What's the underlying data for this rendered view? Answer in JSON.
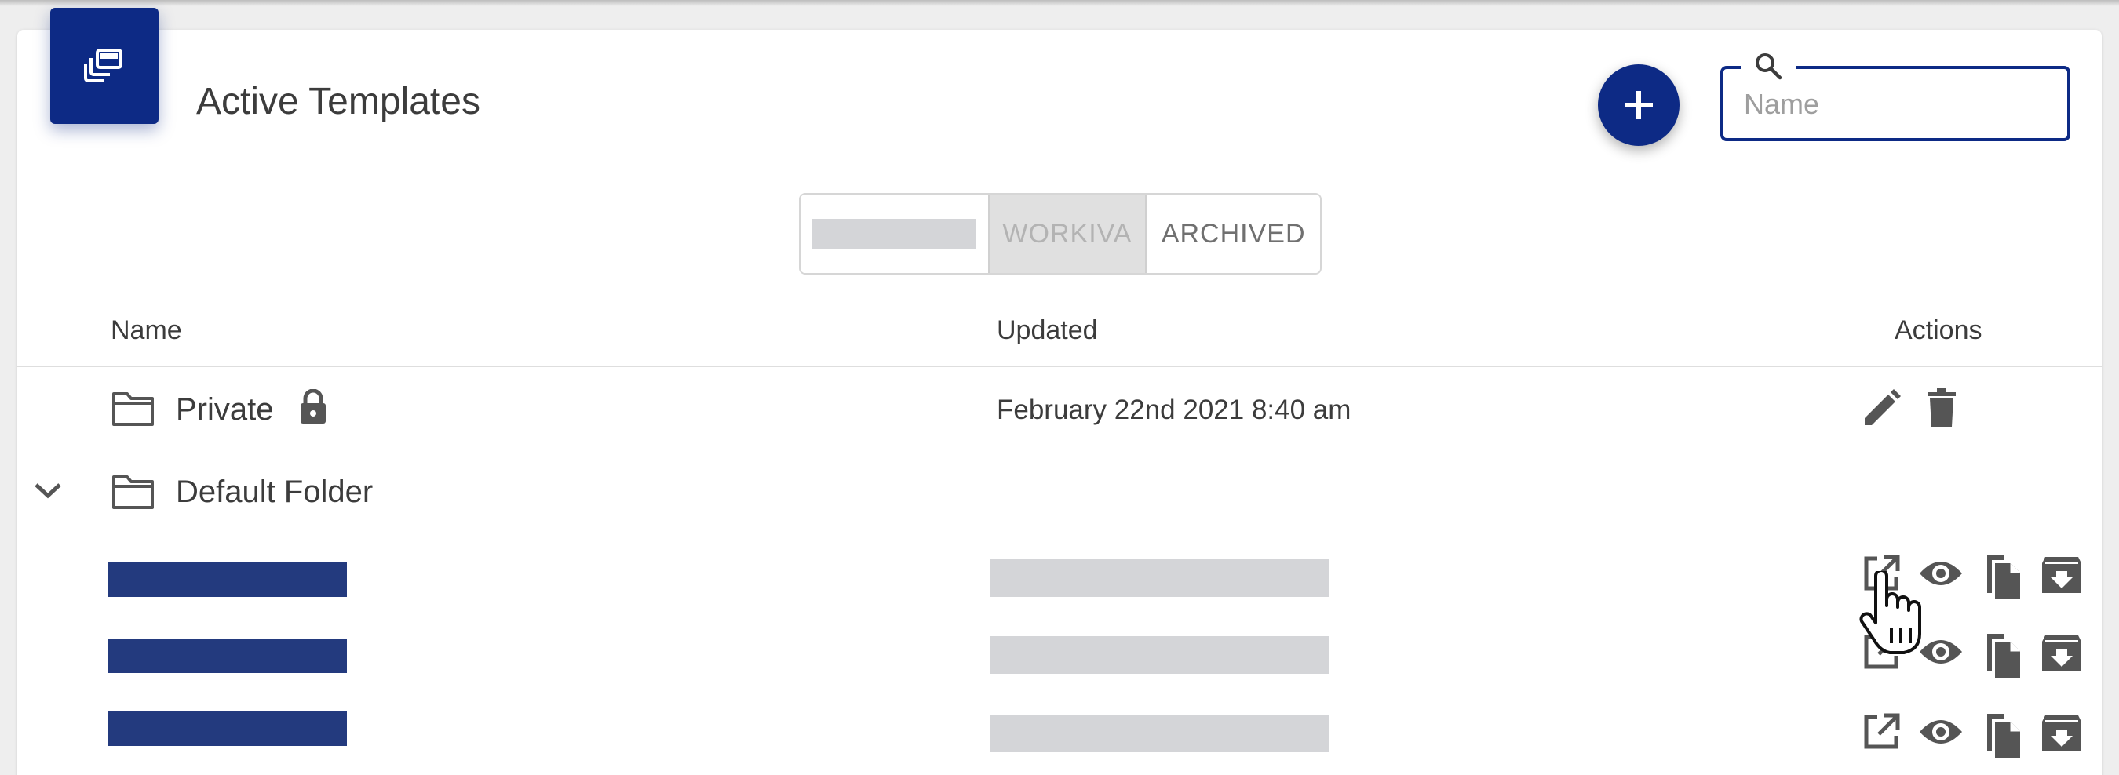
{
  "header": {
    "title": "Active Templates",
    "search_placeholder": "Name",
    "search_value": ""
  },
  "toggle": {
    "tabs": [
      "",
      "WORKIVA",
      "ARCHIVED"
    ],
    "selected": "WORKIVA"
  },
  "table": {
    "columns": [
      "Name",
      "Updated",
      "Actions"
    ],
    "folders": [
      {
        "name": "Private",
        "locked": true,
        "updated": "February 22nd 2021 8:40 am",
        "actions": [
          "edit-icon",
          "delete-icon"
        ]
      },
      {
        "name": "Default Folder",
        "expanded": true
      }
    ],
    "template_actions": [
      "open-external-icon",
      "eye-icon",
      "copy-icon",
      "archive-icon"
    ],
    "template_row_count": 3
  },
  "colors": {
    "brand": "#0d2a85",
    "redacted_name": "#233a7e",
    "redacted_date": "#d4d5d8"
  }
}
